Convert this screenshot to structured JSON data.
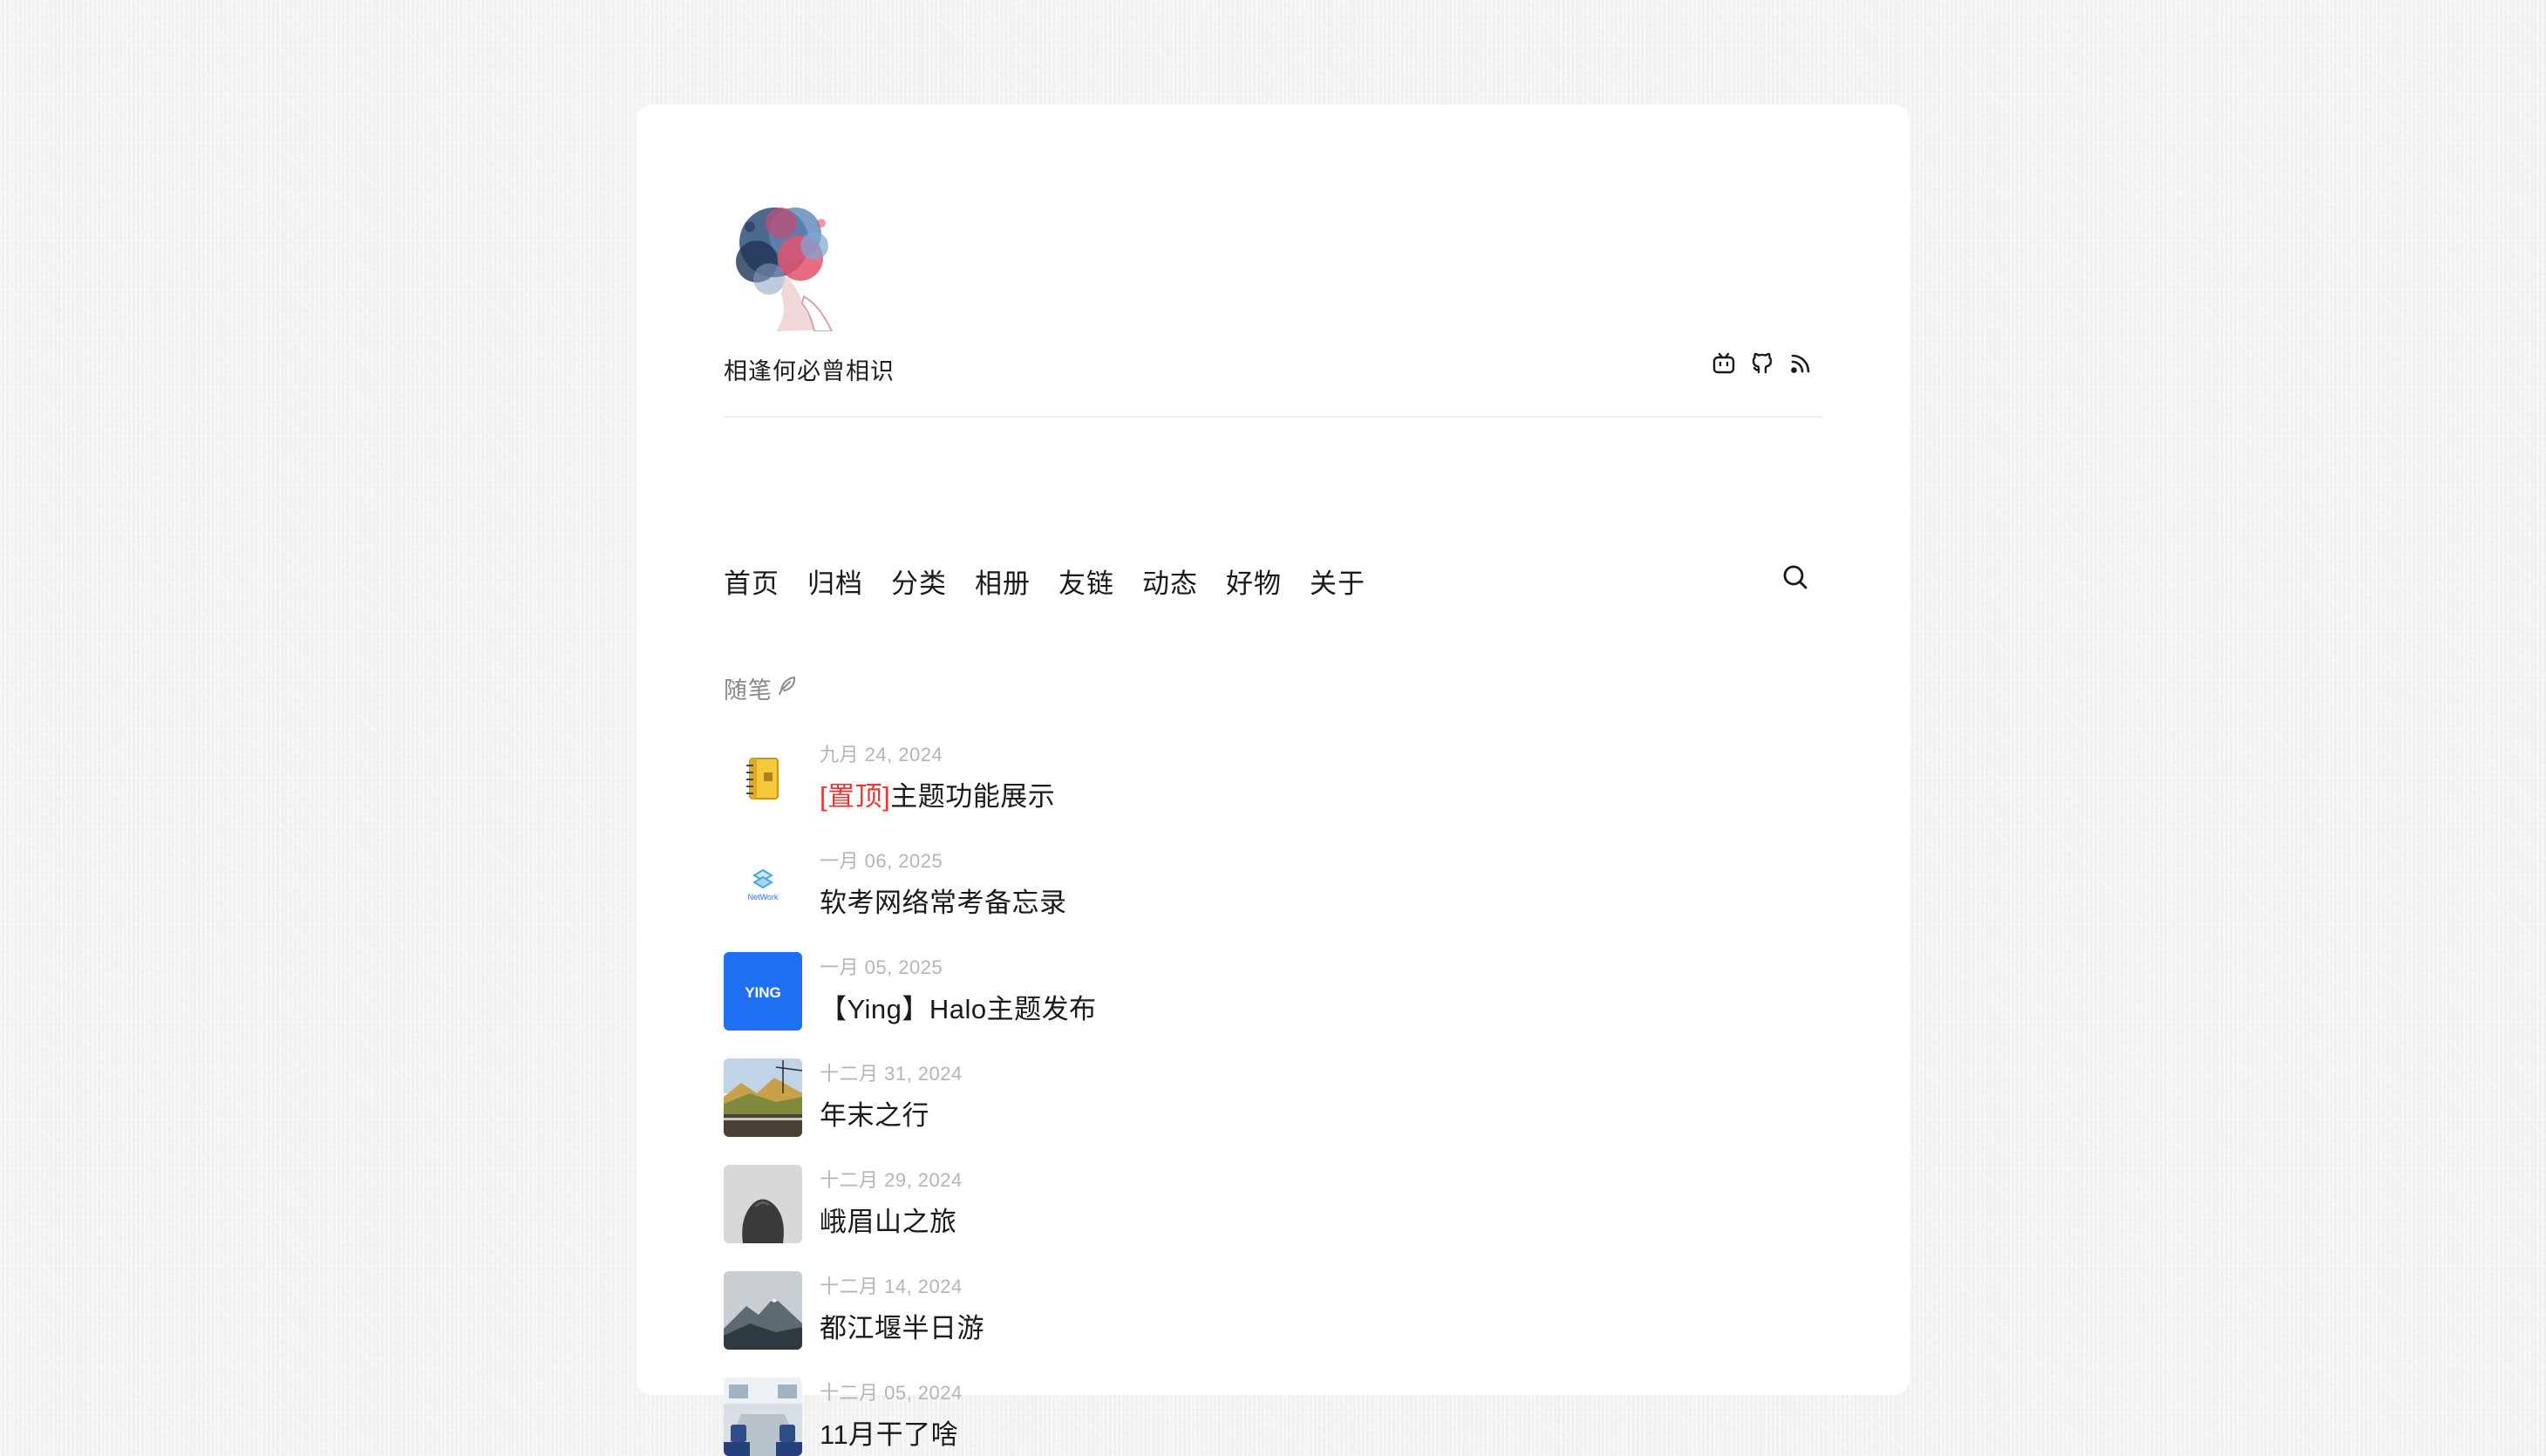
{
  "site": {
    "title": "相逢何必曾相识"
  },
  "social": [
    {
      "icon": "bilibili-icon"
    },
    {
      "icon": "github-icon"
    },
    {
      "icon": "rss-icon"
    }
  ],
  "nav": {
    "items": [
      "首页",
      "归档",
      "分类",
      "相册",
      "友链",
      "动态",
      "好物",
      "关于"
    ]
  },
  "section": {
    "label": "随笔"
  },
  "posts": [
    {
      "date": "九月 24, 2024",
      "pin": "[置顶]",
      "title": "主题功能展示",
      "thumb": "notebook"
    },
    {
      "date": "一月 06, 2025",
      "title": "软考网络常考备忘录",
      "thumb": "network",
      "thumb_text": "NetWork"
    },
    {
      "date": "一月 05, 2025",
      "title": "【Ying】Halo主题发布",
      "thumb": "ying",
      "thumb_text": "YING"
    },
    {
      "date": "十二月 31, 2024",
      "title": "年末之行",
      "thumb": "train-landscape"
    },
    {
      "date": "十二月 29, 2024",
      "title": "峨眉山之旅",
      "thumb": "rock"
    },
    {
      "date": "十二月 14, 2024",
      "title": "都江堰半日游",
      "thumb": "mountain"
    },
    {
      "date": "十二月 05, 2024",
      "title": "11月干了啥",
      "thumb": "train-interior"
    }
  ],
  "colors": {
    "pin": "#e53935",
    "date": "#b5b5b5",
    "accent_blue": "#1f6ff2"
  }
}
